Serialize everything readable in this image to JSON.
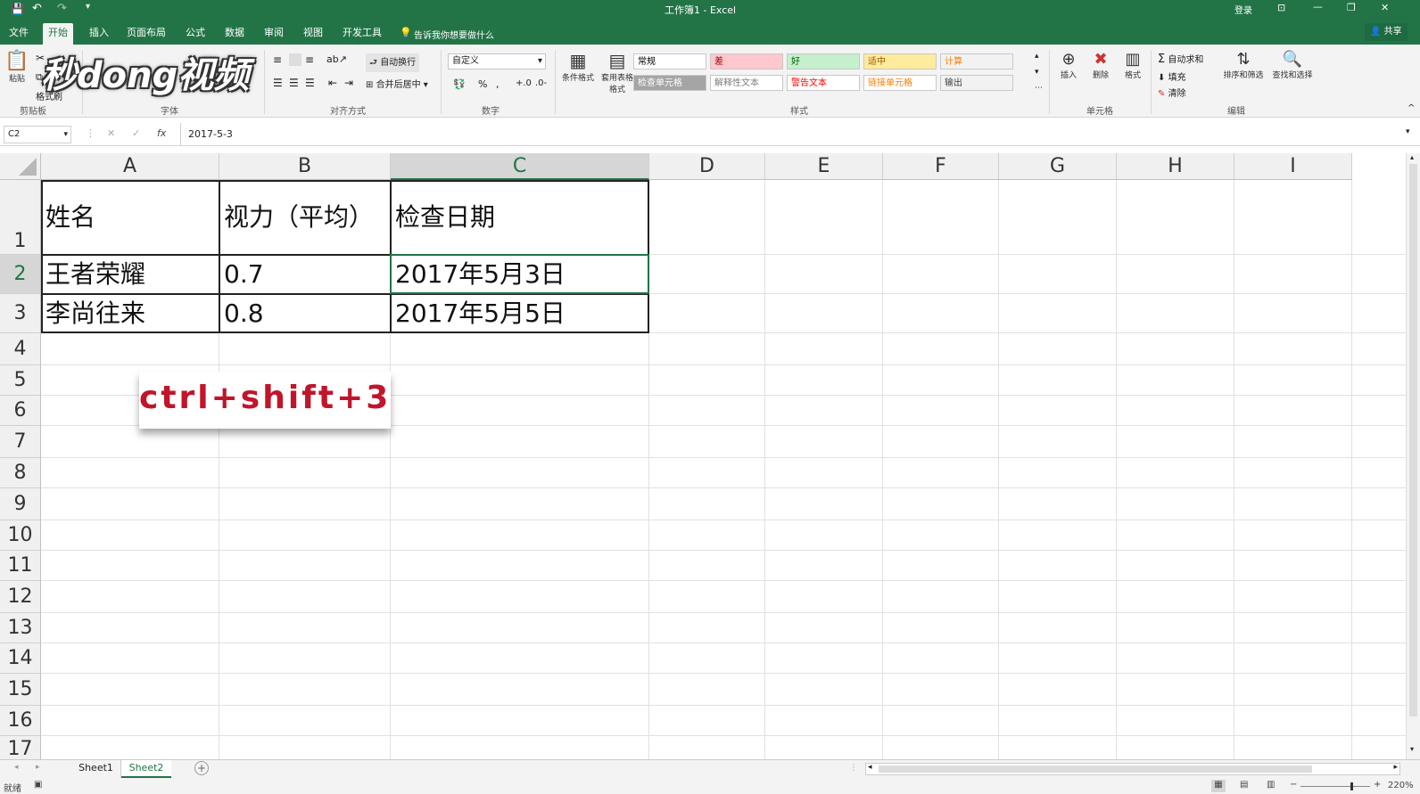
{
  "titlebar": {
    "title": "工作簿1 - Excel",
    "login": "登录",
    "minimize": "—",
    "restore": "❐",
    "close": "✕"
  },
  "tabs": [
    {
      "label": "文件",
      "active": false
    },
    {
      "label": "开始",
      "active": true
    },
    {
      "label": "插入",
      "active": false
    },
    {
      "label": "页面布局",
      "active": false
    },
    {
      "label": "公式",
      "active": false
    },
    {
      "label": "数据",
      "active": false
    },
    {
      "label": "审阅",
      "active": false
    },
    {
      "label": "视图",
      "active": false
    },
    {
      "label": "开发工具",
      "active": false
    }
  ],
  "tell_me": "告诉我你想要做什么",
  "share": "共享",
  "ribbon": {
    "clipboard": {
      "paste": "粘贴",
      "format_painter": "格式刷",
      "label": "剪贴板"
    },
    "font": {
      "label": "字体"
    },
    "alignment": {
      "wrap": "自动换行",
      "merge": "合并后居中",
      "label": "对齐方式"
    },
    "number": {
      "format": "自定义",
      "percent": "%",
      "label": "数字"
    },
    "styles": {
      "conditional": "条件格式",
      "table_format": "套用表格格式",
      "cells": [
        {
          "label": "常规",
          "bg": "#ffffff",
          "fg": "#000000"
        },
        {
          "label": "差",
          "bg": "#ffc7ce",
          "fg": "#9c0006"
        },
        {
          "label": "好",
          "bg": "#c6efce",
          "fg": "#006100"
        },
        {
          "label": "适中",
          "bg": "#ffeb9c",
          "fg": "#9c5700"
        },
        {
          "label": "计算",
          "bg": "#f2f2f2",
          "fg": "#fa7d00"
        },
        {
          "label": "检查单元格",
          "bg": "#a5a5a5",
          "fg": "#ffffff"
        },
        {
          "label": "解释性文本",
          "bg": "#ffffff",
          "fg": "#7f7f7f"
        },
        {
          "label": "警告文本",
          "bg": "#ffffff",
          "fg": "#ff0000"
        },
        {
          "label": "链接单元格",
          "bg": "#ffffff",
          "fg": "#fa7d00"
        },
        {
          "label": "输出",
          "bg": "#f2f2f2",
          "fg": "#3f3f3f"
        }
      ],
      "label": "样式"
    },
    "cells_group": {
      "insert": "插入",
      "delete": "删除",
      "format": "格式",
      "label": "单元格"
    },
    "editing": {
      "autosum": "自动求和",
      "fill": "填充",
      "clear": "清除",
      "sort": "排序和筛选",
      "find": "查找和选择",
      "label": "编辑"
    }
  },
  "formula": {
    "name_box": "C2",
    "fx": "fx",
    "value": "2017-5-3"
  },
  "grid": {
    "columns": [
      "A",
      "B",
      "C",
      "D",
      "E",
      "F",
      "G",
      "H",
      "I"
    ],
    "rows": [
      "1",
      "2",
      "3",
      "4",
      "5",
      "6",
      "7",
      "8",
      "9",
      "10",
      "11",
      "12",
      "13",
      "14",
      "15",
      "16",
      "17"
    ],
    "selected_column": "C",
    "selected_row": "2",
    "cells": {
      "A1": "姓名",
      "B1": "视力（平均）",
      "C1": "检查日期",
      "A2": "王者荣耀",
      "B2": "0.7",
      "C2": "2017年5月3日",
      "A3": "李尚往来",
      "B3": "0.8",
      "C3": "2017年5月5日"
    }
  },
  "callout": "ctrl+shift+3",
  "watermark": "秒dong视频",
  "sheets": [
    {
      "label": "Sheet1",
      "active": false
    },
    {
      "label": "Sheet2",
      "active": true
    }
  ],
  "status": {
    "ready": "就绪",
    "zoom": "220%",
    "zoom_minus": "−",
    "zoom_plus": "+"
  }
}
